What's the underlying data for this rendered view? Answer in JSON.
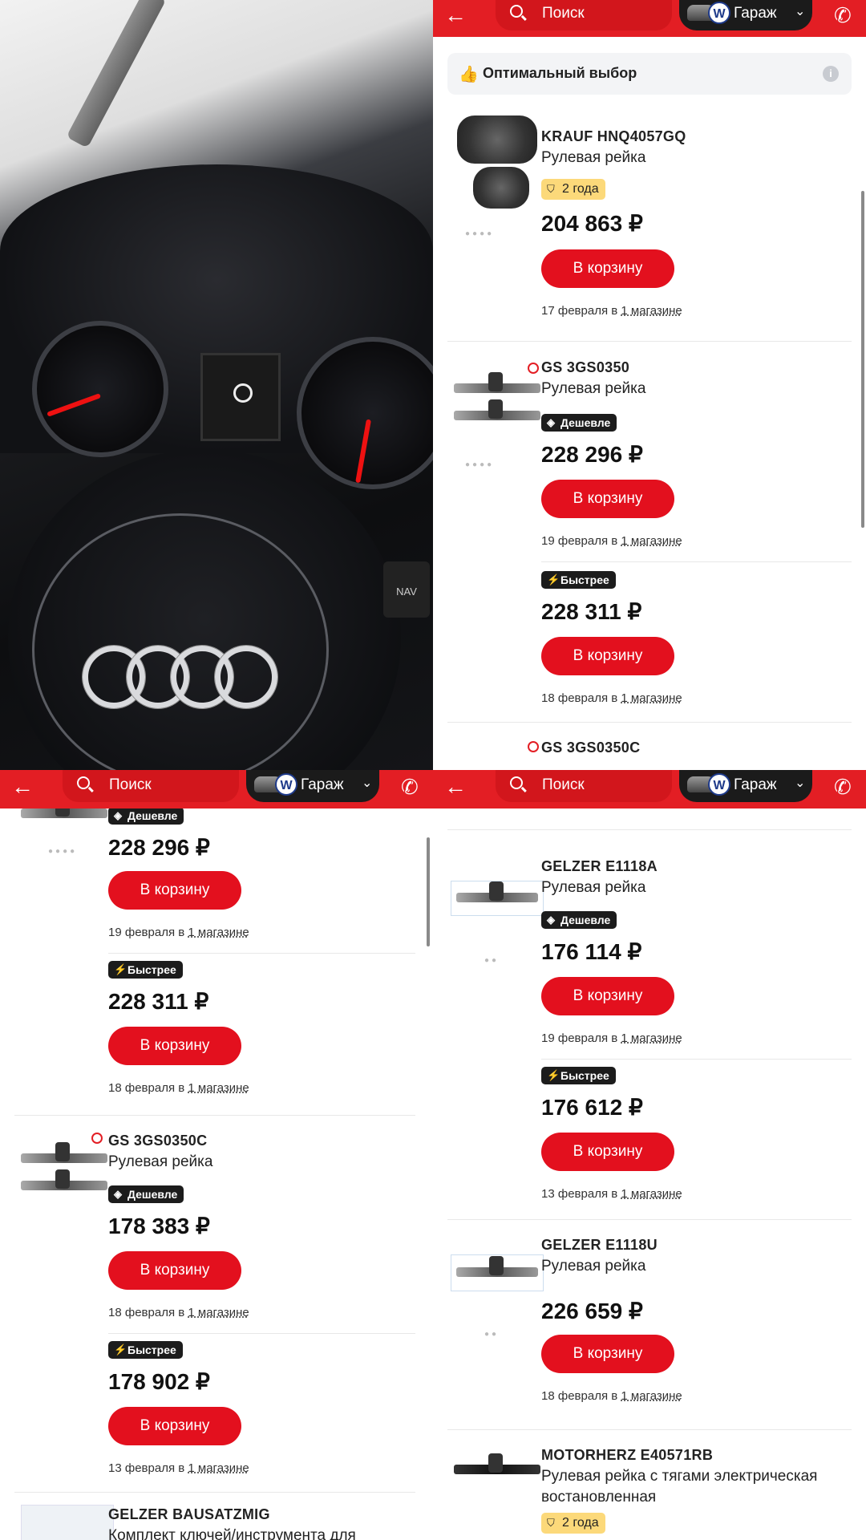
{
  "header": {
    "search_placeholder": "Поиск",
    "garage_label": "Гараж",
    "vw_logo": "W",
    "back_icon": "←",
    "phone_icon": "✆",
    "chevron": "⌄"
  },
  "photo": {
    "nav_label": "NAV"
  },
  "optimal": {
    "label": "Оптимальный выбор",
    "info": "i"
  },
  "badges": {
    "cheaper": "Дешевле",
    "faster": "Быстрее",
    "warranty": "2 года"
  },
  "cart_label": "В корзину",
  "in_word": "в",
  "store_link": "1 магазине",
  "q2": {
    "p1": {
      "brand": "KRAUF  HNQ4057GQ",
      "name": "Рулевая рейка",
      "price": "204 863 ₽",
      "date": "17 февраля"
    },
    "p2": {
      "brand": "GS  3GS0350",
      "name": "Рулевая рейка",
      "o1": {
        "price": "228 296 ₽",
        "date": "19 февраля"
      },
      "o2": {
        "price": "228 311 ₽",
        "date": "18 февраля"
      }
    },
    "p3": {
      "brand": "GS  3GS0350C"
    }
  },
  "q3": {
    "p2": {
      "o1": {
        "price": "228 296 ₽",
        "date": "19 февраля"
      },
      "o2": {
        "price": "228 311 ₽",
        "date": "18 февраля"
      }
    },
    "p3": {
      "brand": "GS  3GS0350C",
      "name": "Рулевая рейка",
      "o1": {
        "price": "178 383 ₽",
        "date": "18 февраля"
      },
      "o2": {
        "price": "178 902 ₽",
        "date": "13 февраля"
      }
    },
    "p4": {
      "brand": "GELZER  BAUSATZMIG",
      "name": "Комплект ключей/инструмента для"
    }
  },
  "q4": {
    "p1": {
      "brand": "GELZER  E1118A",
      "name": "Рулевая рейка",
      "o1": {
        "price": "176 114 ₽",
        "date": "19 февраля"
      },
      "o2": {
        "price": "176 612 ₽",
        "date": "13 февраля"
      }
    },
    "p2": {
      "brand": "GELZER  E1118U",
      "name": "Рулевая рейка",
      "price": "226 659 ₽",
      "date": "18 февраля"
    },
    "p3": {
      "brand": "MOTORHERZ  E40571RB",
      "name": "Рулевая рейка с тягами электрическая востановленная"
    }
  }
}
